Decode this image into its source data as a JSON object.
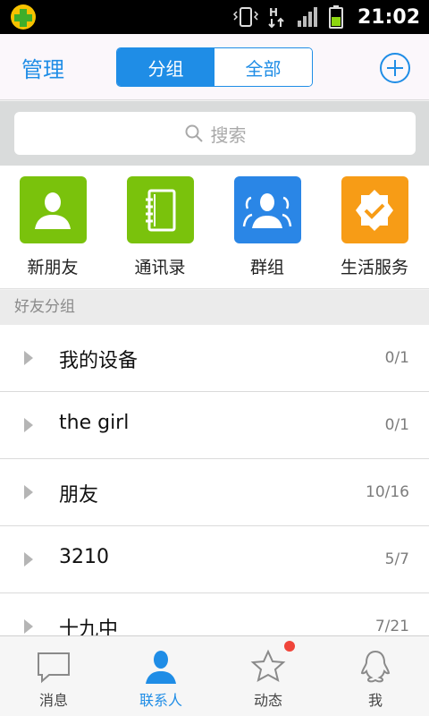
{
  "status_bar": {
    "time": "21:02",
    "icons": [
      "app-badge-icon",
      "vibrate-icon",
      "h-data-icon",
      "signal-icon",
      "battery-icon"
    ],
    "data_indicator": "H"
  },
  "header": {
    "manage_label": "管理",
    "segments": [
      {
        "label": "分组",
        "active": true
      },
      {
        "label": "全部",
        "active": false
      }
    ],
    "add_icon": "plus-circle-icon"
  },
  "search": {
    "placeholder": "搜索",
    "icon": "search-icon"
  },
  "shortcuts": [
    {
      "label": "新朋友",
      "icon": "person-icon",
      "color": "#7ac20c"
    },
    {
      "label": "通讯录",
      "icon": "address-book-icon",
      "color": "#7ac20c"
    },
    {
      "label": "群组",
      "icon": "group-icon",
      "color": "#2a86e6"
    },
    {
      "label": "生活服务",
      "icon": "badge-check-icon",
      "color": "#f79c16"
    }
  ],
  "section_title": "好友分组",
  "groups": [
    {
      "name": "我的设备",
      "count": "0/1"
    },
    {
      "name": "the girl",
      "count": "0/1"
    },
    {
      "name": "朋友",
      "count": "10/16"
    },
    {
      "name": "3210",
      "count": "5/7"
    },
    {
      "name": "十九中",
      "count": "7/21"
    }
  ],
  "tabs": [
    {
      "label": "消息",
      "icon": "message-icon",
      "active": false
    },
    {
      "label": "联系人",
      "icon": "contact-icon",
      "active": true
    },
    {
      "label": "动态",
      "icon": "star-icon",
      "active": false,
      "has_badge": true
    },
    {
      "label": "我",
      "icon": "penguin-icon",
      "active": false
    }
  ],
  "colors": {
    "accent": "#1f8de6",
    "badge": "#f0453a"
  }
}
